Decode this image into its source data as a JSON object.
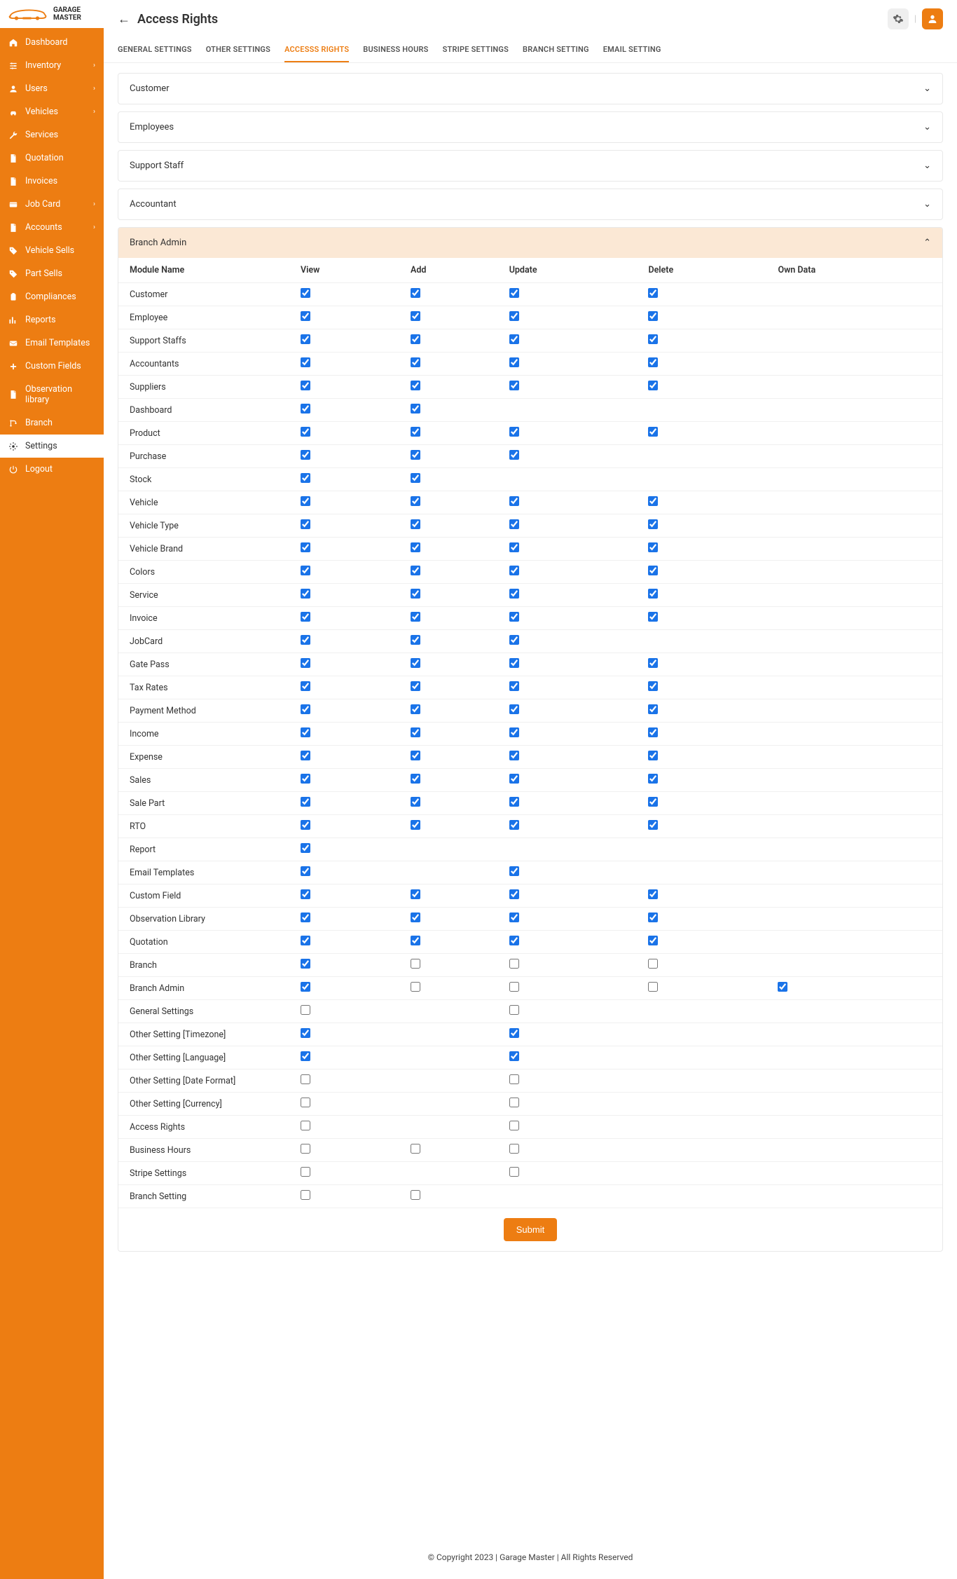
{
  "brand": {
    "line1": "GARAGE",
    "line2": "MASTER"
  },
  "page_title": "Access Rights",
  "sidebar": {
    "items": [
      {
        "label": "Dashboard",
        "icon": "home",
        "sub": false
      },
      {
        "label": "Inventory",
        "icon": "sliders",
        "sub": true
      },
      {
        "label": "Users",
        "icon": "user",
        "sub": true
      },
      {
        "label": "Vehicles",
        "icon": "car",
        "sub": true
      },
      {
        "label": "Services",
        "icon": "wrench",
        "sub": false
      },
      {
        "label": "Quotation",
        "icon": "file",
        "sub": false
      },
      {
        "label": "Invoices",
        "icon": "file",
        "sub": false
      },
      {
        "label": "Job Card",
        "icon": "card",
        "sub": true
      },
      {
        "label": "Accounts",
        "icon": "file",
        "sub": true
      },
      {
        "label": "Vehicle Sells",
        "icon": "tag",
        "sub": false
      },
      {
        "label": "Part Sells",
        "icon": "tag",
        "sub": false
      },
      {
        "label": "Compliances",
        "icon": "clip",
        "sub": false
      },
      {
        "label": "Reports",
        "icon": "chart",
        "sub": false
      },
      {
        "label": "Email Templates",
        "icon": "mail",
        "sub": false
      },
      {
        "label": "Custom Fields",
        "icon": "plus",
        "sub": false
      },
      {
        "label": "Observation library",
        "icon": "file",
        "sub": false
      },
      {
        "label": "Branch",
        "icon": "branch",
        "sub": false
      },
      {
        "label": "Settings",
        "icon": "gear",
        "sub": false,
        "active": true
      },
      {
        "label": "Logout",
        "icon": "power",
        "sub": false
      }
    ]
  },
  "tabs": [
    {
      "label": "GENERAL SETTINGS"
    },
    {
      "label": "OTHER SETTINGS"
    },
    {
      "label": "ACCESSS RIGHTS",
      "active": true
    },
    {
      "label": "BUSINESS HOURS"
    },
    {
      "label": "STRIPE SETTINGS"
    },
    {
      "label": "BRANCH SETTING"
    },
    {
      "label": "EMAIL SETTING"
    }
  ],
  "accordions": [
    {
      "title": "Customer"
    },
    {
      "title": "Employees"
    },
    {
      "title": "Support Staff"
    },
    {
      "title": "Accountant"
    },
    {
      "title": "Branch Admin",
      "open": true
    }
  ],
  "columns": [
    "Module Name",
    "View",
    "Add",
    "Update",
    "Delete",
    "Own Data"
  ],
  "rows": [
    {
      "m": "Customer",
      "c": [
        1,
        1,
        1,
        1,
        null
      ]
    },
    {
      "m": "Employee",
      "c": [
        1,
        1,
        1,
        1,
        null
      ]
    },
    {
      "m": "Support Staffs",
      "c": [
        1,
        1,
        1,
        1,
        null
      ]
    },
    {
      "m": "Accountants",
      "c": [
        1,
        1,
        1,
        1,
        null
      ]
    },
    {
      "m": "Suppliers",
      "c": [
        1,
        1,
        1,
        1,
        null
      ]
    },
    {
      "m": "Dashboard",
      "c": [
        1,
        1,
        null,
        null,
        null
      ]
    },
    {
      "m": "Product",
      "c": [
        1,
        1,
        1,
        1,
        null
      ]
    },
    {
      "m": "Purchase",
      "c": [
        1,
        1,
        1,
        null,
        null
      ]
    },
    {
      "m": "Stock",
      "c": [
        1,
        1,
        null,
        null,
        null
      ]
    },
    {
      "m": "Vehicle",
      "c": [
        1,
        1,
        1,
        1,
        null
      ]
    },
    {
      "m": "Vehicle Type",
      "c": [
        1,
        1,
        1,
        1,
        null
      ]
    },
    {
      "m": "Vehicle Brand",
      "c": [
        1,
        1,
        1,
        1,
        null
      ]
    },
    {
      "m": "Colors",
      "c": [
        1,
        1,
        1,
        1,
        null
      ]
    },
    {
      "m": "Service",
      "c": [
        1,
        1,
        1,
        1,
        null
      ]
    },
    {
      "m": "Invoice",
      "c": [
        1,
        1,
        1,
        1,
        null
      ]
    },
    {
      "m": "JobCard",
      "c": [
        1,
        1,
        1,
        null,
        null
      ]
    },
    {
      "m": "Gate Pass",
      "c": [
        1,
        1,
        1,
        1,
        null
      ]
    },
    {
      "m": "Tax Rates",
      "c": [
        1,
        1,
        1,
        1,
        null
      ]
    },
    {
      "m": "Payment Method",
      "c": [
        1,
        1,
        1,
        1,
        null
      ]
    },
    {
      "m": "Income",
      "c": [
        1,
        1,
        1,
        1,
        null
      ]
    },
    {
      "m": "Expense",
      "c": [
        1,
        1,
        1,
        1,
        null
      ]
    },
    {
      "m": "Sales",
      "c": [
        1,
        1,
        1,
        1,
        null
      ]
    },
    {
      "m": "Sale Part",
      "c": [
        1,
        1,
        1,
        1,
        null
      ]
    },
    {
      "m": "RTO",
      "c": [
        1,
        1,
        1,
        1,
        null
      ]
    },
    {
      "m": "Report",
      "c": [
        1,
        null,
        null,
        null,
        null
      ]
    },
    {
      "m": "Email Templates",
      "c": [
        1,
        null,
        1,
        null,
        null
      ]
    },
    {
      "m": "Custom Field",
      "c": [
        1,
        1,
        1,
        1,
        null
      ]
    },
    {
      "m": "Observation Library",
      "c": [
        1,
        1,
        1,
        1,
        null
      ]
    },
    {
      "m": "Quotation",
      "c": [
        1,
        1,
        1,
        1,
        null
      ]
    },
    {
      "m": "Branch",
      "c": [
        1,
        0,
        0,
        0,
        null
      ]
    },
    {
      "m": "Branch Admin",
      "c": [
        1,
        0,
        0,
        0,
        1
      ]
    },
    {
      "m": "General Settings",
      "c": [
        0,
        null,
        0,
        null,
        null
      ]
    },
    {
      "m": "Other Setting [Timezone]",
      "c": [
        1,
        null,
        1,
        null,
        null
      ]
    },
    {
      "m": "Other Setting [Language]",
      "c": [
        1,
        null,
        1,
        null,
        null
      ]
    },
    {
      "m": "Other Setting [Date Format]",
      "c": [
        0,
        null,
        0,
        null,
        null
      ]
    },
    {
      "m": "Other Setting [Currency]",
      "c": [
        0,
        null,
        0,
        null,
        null
      ]
    },
    {
      "m": "Access Rights",
      "c": [
        0,
        null,
        0,
        null,
        null
      ]
    },
    {
      "m": "Business Hours",
      "c": [
        0,
        0,
        0,
        null,
        null
      ]
    },
    {
      "m": "Stripe Settings",
      "c": [
        0,
        null,
        0,
        null,
        null
      ]
    },
    {
      "m": "Branch Setting",
      "c": [
        0,
        0,
        null,
        null,
        null
      ]
    }
  ],
  "submit_label": "Submit",
  "footer": "© Copyright 2023 | Garage Master | All Rights Reserved"
}
